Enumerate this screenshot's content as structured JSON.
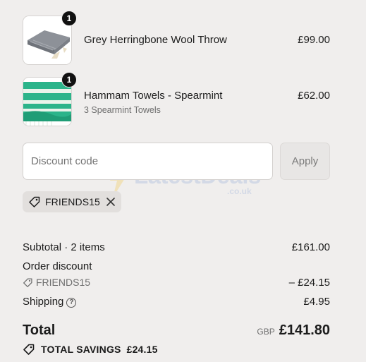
{
  "items": [
    {
      "title": "Grey Herringbone Wool Throw",
      "variant": "",
      "price": "£99.00",
      "quantity": "1",
      "thumb_icon": "grey-wool-throw-image"
    },
    {
      "title": "Hammam Towels - Spearmint",
      "variant": "3 Spearmint Towels",
      "price": "£62.00",
      "quantity": "1",
      "thumb_icon": "spearmint-towels-image"
    }
  ],
  "discount": {
    "placeholder": "Discount code",
    "apply_label": "Apply",
    "applied_code": "FRIENDS15"
  },
  "watermark": {
    "text": "LatestDeals",
    "sub": ".co.uk"
  },
  "summary": {
    "subtotal_label": "Subtotal · 2 items",
    "subtotal_value": "£161.00",
    "order_discount_label": "Order discount",
    "order_discount_code": "FRIENDS15",
    "order_discount_value": "– £24.15",
    "shipping_label": "Shipping",
    "shipping_value": "£4.95",
    "total_label": "Total",
    "currency": "GBP",
    "total_value": "£141.80",
    "savings_label": "TOTAL SAVINGS",
    "savings_value": "£24.15"
  },
  "colors": {
    "background": "#f0eeed",
    "badge": "#111111",
    "towel_green": "#2bb48a"
  }
}
